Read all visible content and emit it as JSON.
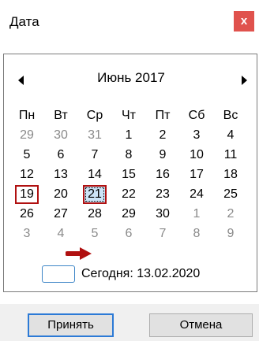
{
  "window": {
    "title": "Дата",
    "close_label": "x"
  },
  "calendar": {
    "month_label": "Июнь 2017",
    "weekdays": [
      "Пн",
      "Вт",
      "Ср",
      "Чт",
      "Пт",
      "Сб",
      "Вс"
    ],
    "weeks": [
      [
        "29",
        "30",
        "31",
        "1",
        "2",
        "3",
        "4"
      ],
      [
        "5",
        "6",
        "7",
        "8",
        "9",
        "10",
        "11"
      ],
      [
        "12",
        "13",
        "14",
        "15",
        "16",
        "17",
        "18"
      ],
      [
        "19",
        "20",
        "21",
        "22",
        "23",
        "24",
        "25"
      ],
      [
        "26",
        "27",
        "28",
        "29",
        "30",
        "1",
        "2"
      ],
      [
        "3",
        "4",
        "5",
        "6",
        "7",
        "8",
        "9"
      ]
    ],
    "today_label": "Сегодня: 13.02.2020",
    "annotation_color": "#b01010",
    "selected_bg": "#cce4f7"
  },
  "footer": {
    "accept_label": "Принять",
    "cancel_label": "Отмена"
  }
}
